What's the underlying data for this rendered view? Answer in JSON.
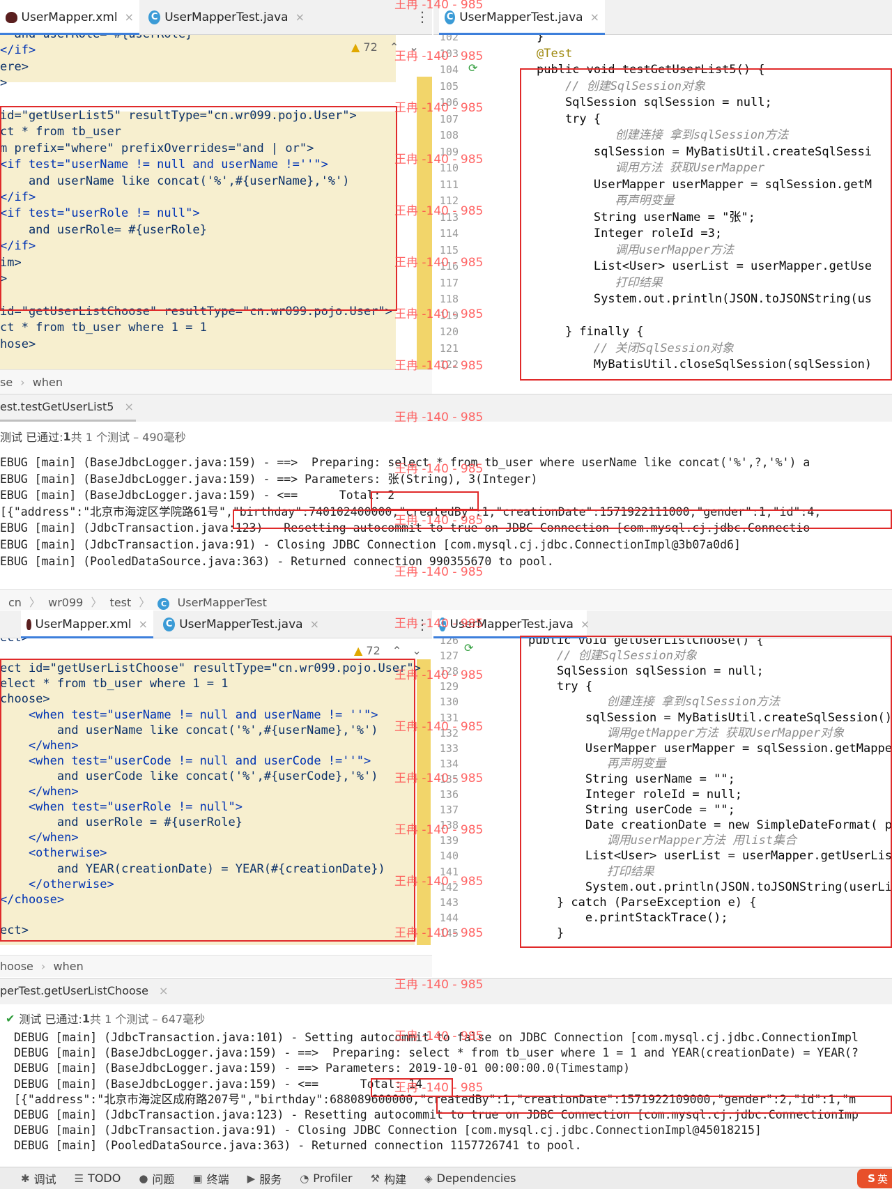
{
  "top": {
    "left_tabs": [
      {
        "label": "UserMapper.xml",
        "close": "×"
      },
      {
        "label": "UserMapperTest.java",
        "close": "×"
      }
    ],
    "right_tab": {
      "label": "UserMapperTest.java",
      "close": "×"
    },
    "warning_count": "72",
    "xml_lines": [
      "  and userRole= #{userRole}",
      "</if>",
      "ere>",
      ">",
      "",
      "id=\"getUserList5\" resultType=\"cn.wr099.pojo.User\">",
      "ct * from tb_user",
      "m prefix=\"where\" prefixOverrides=\"and | or\">",
      "<if test=\"userName != null and userName !=''\">",
      "    and userName like concat('%',#{userName},'%')",
      "</if>",
      "<if test=\"userRole != null\">",
      "    and userRole= #{userRole}",
      "</if>",
      "im>",
      ">",
      "",
      "id=\"getUserListChoose\" resultType=\"cn.wr099.pojo.User\">",
      "ct * from tb_user where 1 = 1",
      "hose>"
    ],
    "java_line_numbers": [
      "102",
      "103",
      "104",
      "105",
      "106",
      "107",
      "108",
      "109",
      "110",
      "111",
      "112",
      "113",
      "114",
      "115",
      "116",
      "117",
      "118",
      "119",
      "120",
      "121",
      "122"
    ],
    "java_lines": [
      "}",
      "@Test",
      "public void testGetUserList5() {",
      "    // 创建SqlSession对象",
      "    SqlSession sqlSession = null;",
      "    try {",
      "           创建连接 拿到sqlSession方法",
      "        sqlSession = MyBatisUtil.createSqlSessi",
      "           调用方法 获取UserMapper",
      "        UserMapper userMapper = sqlSession.getM",
      "           再声明变量",
      "        String userName = \"张\";",
      "        Integer roleId =3;",
      "           调用userMapper方法",
      "        List<User> userList = userMapper.getUse",
      "           打印结果",
      "        System.out.println(JSON.toJSONString(us",
      "",
      "    } finally {",
      "        // 关闭SqlSession对象",
      "        MyBatisUtil.closeSqlSession(sqlSession)"
    ],
    "breadcrumb": [
      "se",
      "when"
    ],
    "run_tab": "est.testGetUserList5",
    "run_status_prefix": "测试 已通过: ",
    "run_status_count": "1",
    "run_status_suffix": "共 1 个测试 – 490毫秒",
    "console": [
      "EBUG [main] (BaseJdbcLogger.java:159) - ==>  Preparing: select * from tb_user where userName like concat('%',?,'%') a",
      "EBUG [main] (BaseJdbcLogger.java:159) - ==> Parameters: 张(String), 3(Integer)",
      "EBUG [main] (BaseJdbcLogger.java:159) - <==      Total: 2",
      "[{\"address\":\"北京市海淀区学院路61号\",\"birthday\":740102400000,\"createdBy\":1,\"creationDate\":1571922111000,\"gender\":1,\"id\":4,",
      "EBUG [main] (JdbcTransaction.java:123) - Resetting autocommit to true on JDBC Connection [com.mysql.cj.jdbc.Connectio",
      "EBUG [main] (JdbcTransaction.java:91) - Closing JDBC Connection [com.mysql.cj.jdbc.ConnectionImpl@3b07a0d6]",
      "EBUG [main] (PooledDataSource.java:363) - Returned connection 990355670 to pool."
    ]
  },
  "path_bar": [
    "cn",
    "wr099",
    "test",
    "UserMapperTest"
  ],
  "bottom": {
    "left_tabs": [
      {
        "label": "UserMapper.xml",
        "close": "×"
      },
      {
        "label": "UserMapperTest.java",
        "close": "×"
      }
    ],
    "right_tab": {
      "label": "UserMapperTest.java",
      "close": "×"
    },
    "warning_count": "72",
    "xml_lines": [
      "ect>",
      "",
      "ect id=\"getUserListChoose\" resultType=\"cn.wr099.pojo.User\">",
      "elect * from tb_user where 1 = 1",
      "choose>",
      "    <when test=\"userName != null and userName != ''\">",
      "        and userName like concat('%',#{userName},'%')",
      "    </when>",
      "    <when test=\"userCode != null and userCode !=''\">",
      "        and userCode like concat('%',#{userCode},'%')",
      "    </when>",
      "    <when test=\"userRole != null\">",
      "        and userRole = #{userRole}",
      "    </when>",
      "    <otherwise>",
      "        and YEAR(creationDate) = YEAR(#{creationDate})",
      "    </otherwise>",
      "</choose>",
      "",
      "ect>"
    ],
    "java_line_numbers": [
      "126",
      "127",
      "128",
      "129",
      "130",
      "131",
      "132",
      "133",
      "134",
      "135",
      "136",
      "137",
      "138",
      "139",
      "140",
      "141",
      "142",
      "143",
      "144",
      "145"
    ],
    "java_lines": [
      "public void getUserListChoose() {",
      "    // 创建SqlSession对象",
      "    SqlSession sqlSession = null;",
      "    try {",
      "           创建连接 拿到sqlSession方法",
      "        sqlSession = MyBatisUtil.createSqlSession()",
      "           调用getMapper方法 获取UserMapper对象",
      "        UserMapper userMapper = sqlSession.getMappe",
      "           再声明变量",
      "        String userName = \"\";",
      "        Integer roleId = null;",
      "        String userCode = \"\";",
      "        Date creationDate = new SimpleDateFormat( p",
      "           调用userMapper方法 用list集合",
      "        List<User> userList = userMapper.getUserLis",
      "           打印结果",
      "        System.out.println(JSON.toJSONString(userLi",
      "    } catch (ParseException e) {",
      "        e.printStackTrace();",
      "    }"
    ],
    "breadcrumb": [
      "hoose",
      "when"
    ],
    "run_tab": "perTest.getUserListChoose",
    "run_status_prefix": "测试 已通过: ",
    "run_status_count": "1",
    "run_status_suffix": "共 1 个测试 – 647毫秒",
    "console": [
      "DEBUG [main] (JdbcTransaction.java:101) - Setting autocommit to false on JDBC Connection [com.mysql.cj.jdbc.ConnectionImpl",
      "DEBUG [main] (BaseJdbcLogger.java:159) - ==>  Preparing: select * from tb_user where 1 = 1 and YEAR(creationDate) = YEAR(?",
      "DEBUG [main] (BaseJdbcLogger.java:159) - ==> Parameters: 2019-10-01 00:00:00.0(Timestamp)",
      "DEBUG [main] (BaseJdbcLogger.java:159) - <==      Total: 14",
      "[{\"address\":\"北京市海淀区成府路207号\",\"birthday\":688089600000,\"createdBy\":1,\"creationDate\":1571922109000,\"gender\":2,\"id\":1,\"m",
      "DEBUG [main] (JdbcTransaction.java:123) - Resetting autocommit to true on JDBC Connection [com.mysql.cj.jdbc.ConnectionImp",
      "DEBUG [main] (JdbcTransaction.java:91) - Closing JDBC Connection [com.mysql.cj.jdbc.ConnectionImpl@45018215]",
      "DEBUG [main] (PooledDataSource.java:363) - Returned connection 1157726741 to pool."
    ]
  },
  "watermark": "王冉 -140 - 985",
  "toolbar": [
    {
      "icon": "bug-icon",
      "label": "调试"
    },
    {
      "icon": "list-icon",
      "label": "TODO"
    },
    {
      "icon": "info-icon",
      "label": "问题"
    },
    {
      "icon": "terminal-icon",
      "label": "终端"
    },
    {
      "icon": "services-icon",
      "label": "服务"
    },
    {
      "icon": "profiler-icon",
      "label": "Profiler"
    },
    {
      "icon": "hammer-icon",
      "label": "构建"
    },
    {
      "icon": "layers-icon",
      "label": "Dependencies"
    }
  ],
  "ime_badge": "英"
}
